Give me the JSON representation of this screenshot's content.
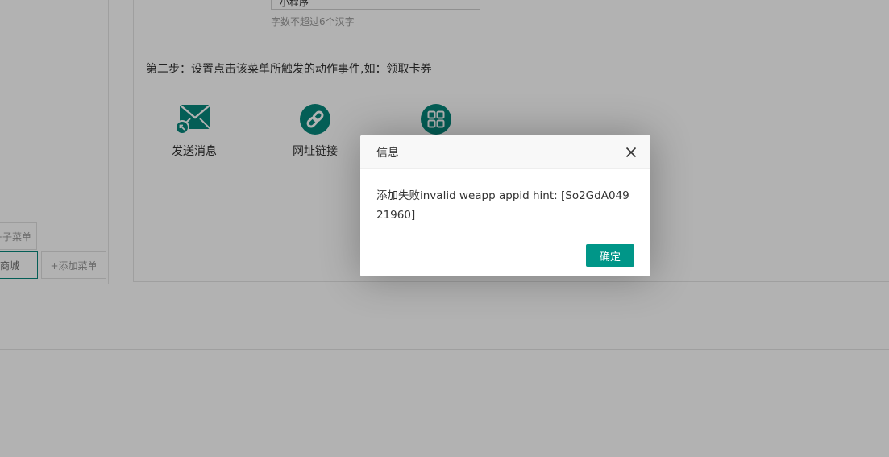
{
  "menu_name_input": {
    "value": "小程序"
  },
  "menu_name_hint": "字数不超过6个汉字",
  "step2": {
    "title": "第二步：设置点击该菜单所触发的动作事件,如：领取卡券"
  },
  "actions": [
    {
      "label": "发送消息",
      "icon": "envelope-icon"
    },
    {
      "label": "网址链接",
      "icon": "link-icon"
    },
    {
      "label": "",
      "icon": "grid-apps-icon"
    }
  ],
  "menu_preview": {
    "sub_menu_label": "+子菜单",
    "shop_label": "商城",
    "add_menu_label": "+添加菜单"
  },
  "dialog": {
    "title": "信息",
    "message": "添加失败invalid weapp appid hint: [So2GdA04921960]",
    "ok_label": "确定"
  },
  "colors": {
    "accent": "#009688",
    "icon_teal": "#07877c",
    "overlay": "rgba(0,0,0,0.3)"
  }
}
